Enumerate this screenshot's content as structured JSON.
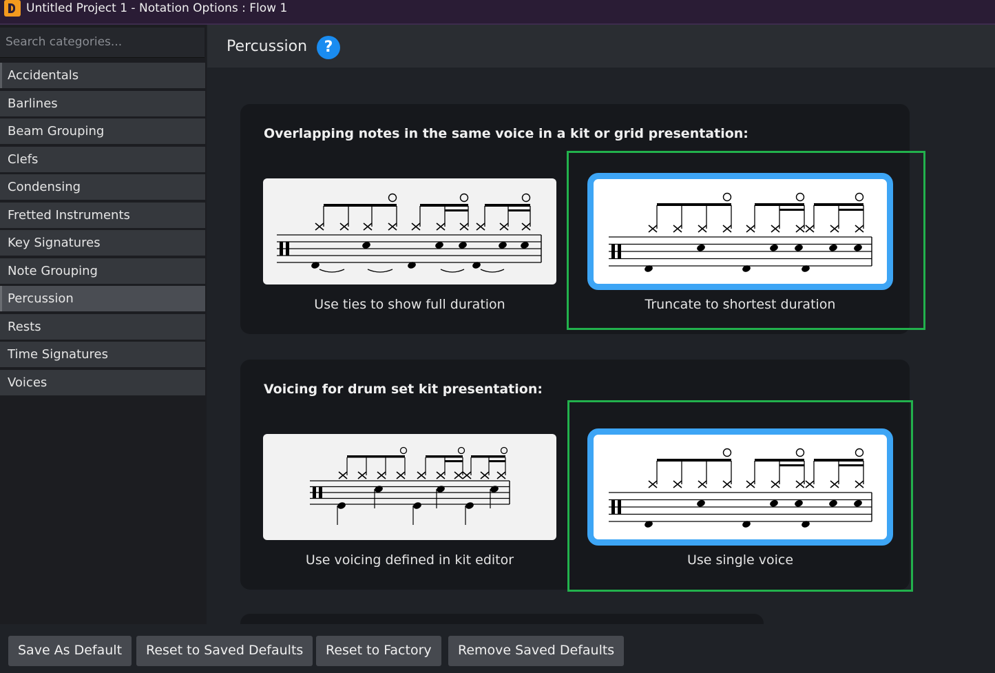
{
  "window": {
    "title": "Untitled Project 1 - Notation Options : Flow 1"
  },
  "sidebar": {
    "search_placeholder": "Search categories...",
    "items": [
      {
        "label": "Accidentals"
      },
      {
        "label": "Barlines"
      },
      {
        "label": "Beam Grouping"
      },
      {
        "label": "Clefs"
      },
      {
        "label": "Condensing"
      },
      {
        "label": "Fretted Instruments"
      },
      {
        "label": "Key Signatures"
      },
      {
        "label": "Note Grouping"
      },
      {
        "label": "Percussion"
      },
      {
        "label": "Rests"
      },
      {
        "label": "Time Signatures"
      },
      {
        "label": "Voices"
      }
    ],
    "selected": "Percussion"
  },
  "main": {
    "title": "Percussion",
    "help_symbol": "?",
    "sections": [
      {
        "title": "Overlapping notes in the same voice in a kit or grid presentation:",
        "options": [
          {
            "label": "Use ties to show full duration",
            "selected": false
          },
          {
            "label": "Truncate to shortest duration",
            "selected": true
          }
        ]
      },
      {
        "title": "Voicing for drum set kit presentation:",
        "options": [
          {
            "label": "Use voicing defined in kit editor",
            "selected": false
          },
          {
            "label": "Use single voice",
            "selected": true
          }
        ]
      }
    ]
  },
  "footer": {
    "buttons": [
      {
        "label": "Save As Default"
      },
      {
        "label": "Reset to Saved Defaults"
      },
      {
        "label": "Reset to Factory"
      },
      {
        "label": "Remove Saved Defaults"
      }
    ]
  },
  "colors": {
    "accent": "#3da5f5",
    "highlight": "#22b14c",
    "help": "#1a8cf0"
  }
}
